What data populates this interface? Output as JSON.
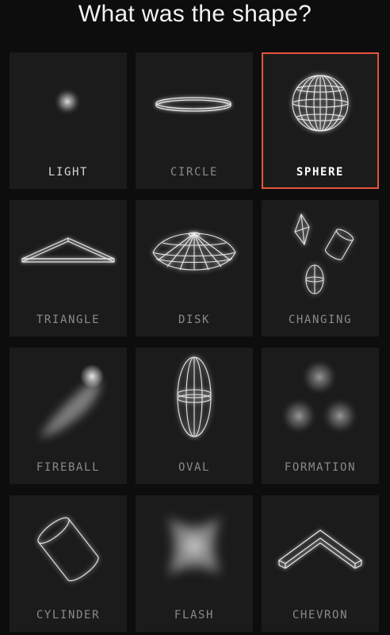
{
  "title": "What was the shape?",
  "accent_color": "#e8553d",
  "selected": "SPHERE",
  "shapes": [
    {
      "label": "LIGHT",
      "icon": "light-glow-icon"
    },
    {
      "label": "CIRCLE",
      "icon": "circle-ring-icon"
    },
    {
      "label": "SPHERE",
      "icon": "sphere-wireframe-icon"
    },
    {
      "label": "TRIANGLE",
      "icon": "triangle-wireframe-icon"
    },
    {
      "label": "DISK",
      "icon": "disk-wireframe-icon"
    },
    {
      "label": "CHANGING",
      "icon": "changing-shapes-icon"
    },
    {
      "label": "FIREBALL",
      "icon": "fireball-icon"
    },
    {
      "label": "OVAL",
      "icon": "oval-wireframe-icon"
    },
    {
      "label": "FORMATION",
      "icon": "formation-lights-icon"
    },
    {
      "label": "CYLINDER",
      "icon": "cylinder-wireframe-icon"
    },
    {
      "label": "FLASH",
      "icon": "flash-glow-icon"
    },
    {
      "label": "CHEVRON",
      "icon": "chevron-wireframe-icon"
    }
  ]
}
